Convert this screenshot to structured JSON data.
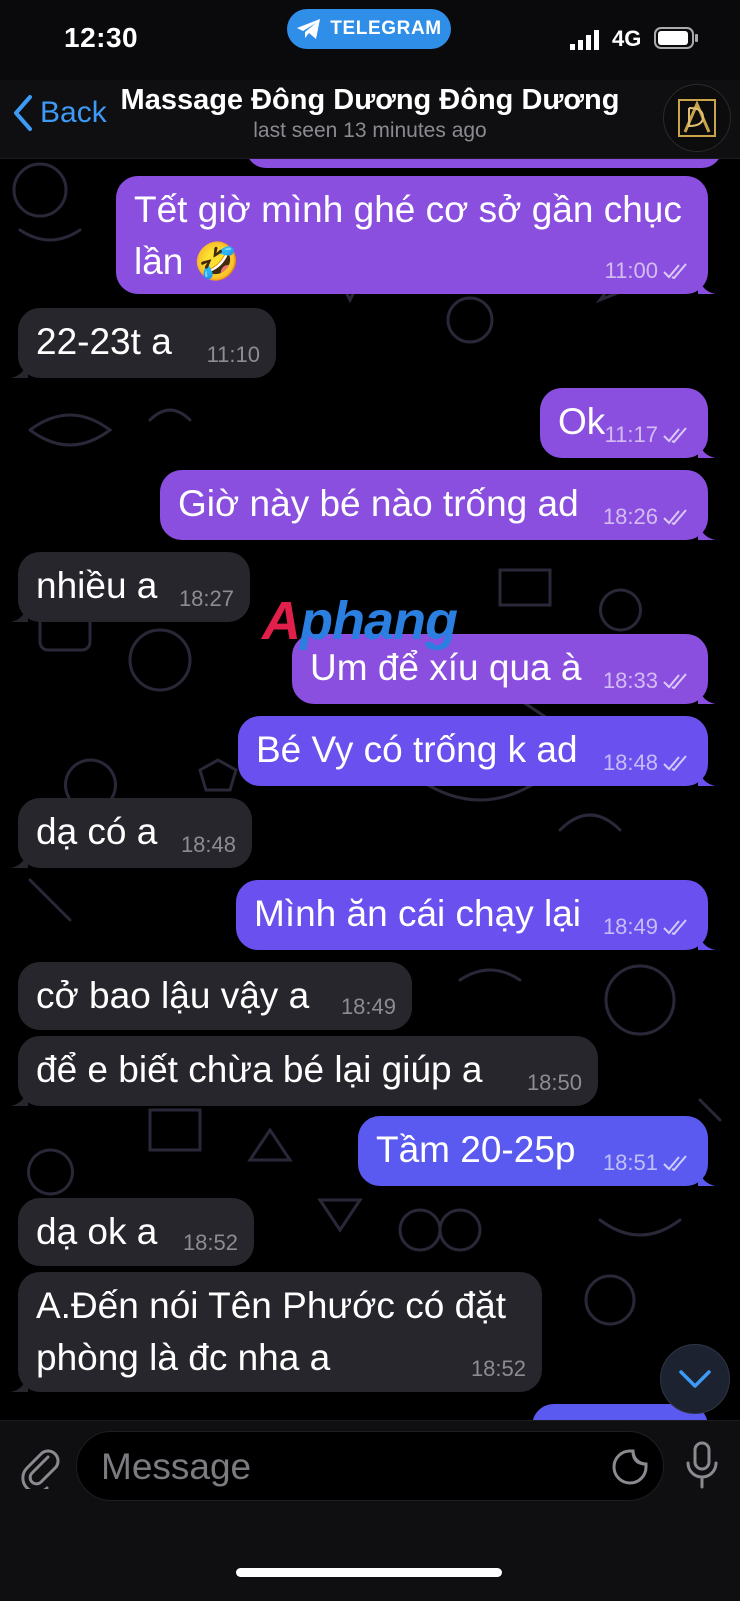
{
  "status_bar": {
    "time": "12:30",
    "app_pill": "TELEGRAM",
    "network": "4G"
  },
  "header": {
    "back_label": "Back",
    "title": "Massage Đông Dương Đông Dương",
    "subtitle": "last seen 13 minutes ago"
  },
  "messages": [
    {
      "dir": "out",
      "text": "Tết giờ mình ghé cơ sở gần chục lần 🤣",
      "time": "11:00"
    },
    {
      "dir": "in",
      "text": "22-23t a",
      "time": "11:10"
    },
    {
      "dir": "out",
      "text": "Ok",
      "time": "11:17"
    },
    {
      "dir": "out",
      "text": "Giờ này bé nào trống ad",
      "time": "18:26"
    },
    {
      "dir": "in",
      "text": "nhiều a",
      "time": "18:27"
    },
    {
      "dir": "out",
      "text": "Um để xíu qua à",
      "time": "18:33"
    },
    {
      "dir": "out",
      "text": "Bé Vy có trống k ad",
      "time": "18:48"
    },
    {
      "dir": "in",
      "text": "dạ có a",
      "time": "18:48"
    },
    {
      "dir": "out",
      "text": "Mình ăn cái chạy lại",
      "time": "18:49"
    },
    {
      "dir": "in",
      "text": "cở bao lậu vậy a",
      "time": "18:49"
    },
    {
      "dir": "in",
      "text": "để e biết chừa bé lại giúp a",
      "time": "18:50"
    },
    {
      "dir": "out",
      "text": "Tầm 20-25p",
      "time": "18:51"
    },
    {
      "dir": "in",
      "text": "dạ ok a",
      "time": "18:52"
    },
    {
      "dir": "in",
      "text": "A.Đến nói Tên Phước có đặt phòng là đc nha a",
      "time": "18:52"
    }
  ],
  "watermark": {
    "part1": "A",
    "part2": "phang"
  },
  "input": {
    "placeholder": "Message"
  },
  "colors": {
    "outgoing_bubble": "#8b4fe0",
    "incoming_bubble": "#26262c",
    "accent": "#3d9af5",
    "telegram_pill": "#2f8fe8"
  },
  "icons": [
    "telegram-icon",
    "signal-icon",
    "battery-icon",
    "back-chevron-icon",
    "avatar-logo",
    "double-check-icon",
    "scroll-down-icon",
    "paperclip-icon",
    "sticker-icon",
    "microphone-icon"
  ]
}
